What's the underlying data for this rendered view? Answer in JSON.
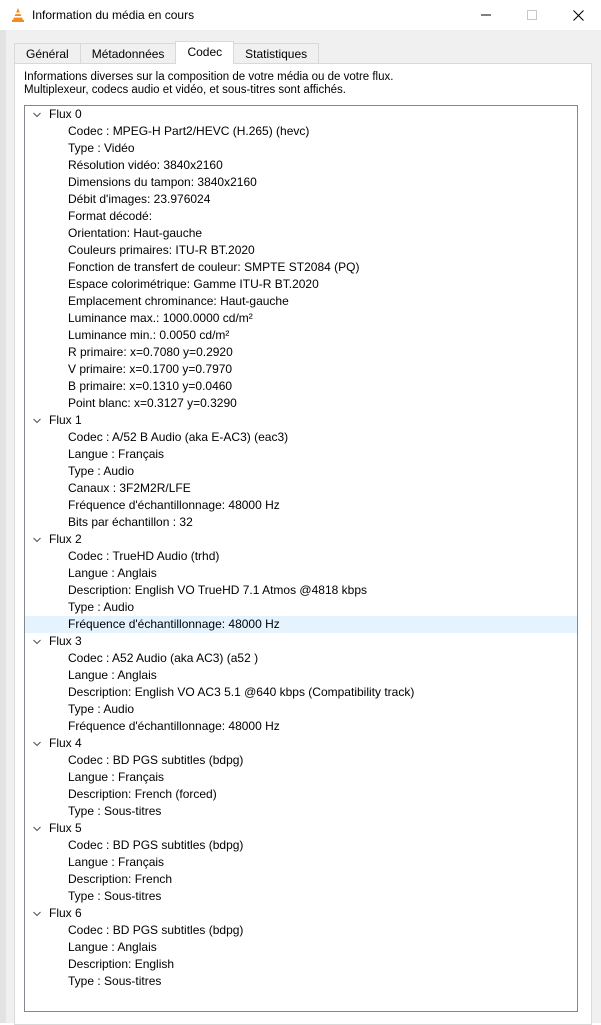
{
  "window": {
    "title": "Information du média en cours",
    "controls": [
      "minimize-icon",
      "maximize-icon",
      "close-icon"
    ]
  },
  "tabs": [
    {
      "label": "Général",
      "active": false
    },
    {
      "label": "Métadonnées",
      "active": false
    },
    {
      "label": "Codec",
      "active": true
    },
    {
      "label": "Statistiques",
      "active": false
    }
  ],
  "description": {
    "line1": "Informations diverses sur la composition de votre média ou de votre flux.",
    "line2": "Multiplexeur, codecs audio et vidéo, et sous-titres sont affichés."
  },
  "streams": [
    {
      "label": "Flux 0",
      "items": [
        "Codec : MPEG-H Part2/HEVC (H.265) (hevc)",
        "Type : Vidéo",
        "Résolution vidéo: 3840x2160",
        "Dimensions du tampon: 3840x2160",
        "Débit d'images: 23.976024",
        "Format décodé:",
        "Orientation: Haut-gauche",
        "Couleurs primaires: ITU-R BT.2020",
        "Fonction de transfert de couleur: SMPTE ST2084 (PQ)",
        "Espace colorimétrique: Gamme ITU-R BT.2020",
        "Emplacement chrominance: Haut-gauche",
        "Luminance max.: 1000.0000 cd/m²",
        "Luminance min.: 0.0050 cd/m²",
        "R primaire: x=0.7080 y=0.2920",
        "V primaire: x=0.1700 y=0.7970",
        "B primaire: x=0.1310 y=0.0460",
        "Point blanc: x=0.3127 y=0.3290"
      ]
    },
    {
      "label": "Flux 1",
      "items": [
        "Codec : A/52 B Audio (aka E-AC3) (eac3)",
        "Langue : Français",
        "Type : Audio",
        "Canaux : 3F2M2R/LFE",
        "Fréquence d'échantillonnage: 48000 Hz",
        "Bits par échantillon : 32"
      ]
    },
    {
      "label": "Flux 2",
      "items": [
        "Codec : TrueHD Audio (trhd)",
        "Langue : Anglais",
        "Description: English VO TrueHD 7.1 Atmos @4818  kbps",
        "Type : Audio",
        "Fréquence d'échantillonnage: 48000 Hz"
      ]
    },
    {
      "label": "Flux 3",
      "items": [
        "Codec : A52 Audio (aka AC3) (a52 )",
        "Langue : Anglais",
        "Description: English VO AC3 5.1 @640  kbps (Compatibility track)",
        "Type : Audio",
        "Fréquence d'échantillonnage: 48000 Hz"
      ]
    },
    {
      "label": "Flux 4",
      "items": [
        "Codec : BD PGS subtitles (bdpg)",
        "Langue : Français",
        "Description: French (forced)",
        "Type : Sous-titres"
      ]
    },
    {
      "label": "Flux 5",
      "items": [
        "Codec : BD PGS subtitles (bdpg)",
        "Langue : Français",
        "Description: French",
        "Type : Sous-titres"
      ]
    },
    {
      "label": "Flux 6",
      "items": [
        "Codec : BD PGS subtitles (bdpg)",
        "Langue : Anglais",
        "Description: English",
        "Type : Sous-titres"
      ]
    }
  ],
  "selected_item": "Fréquence d'échantillonnage: 48000 Hz"
}
